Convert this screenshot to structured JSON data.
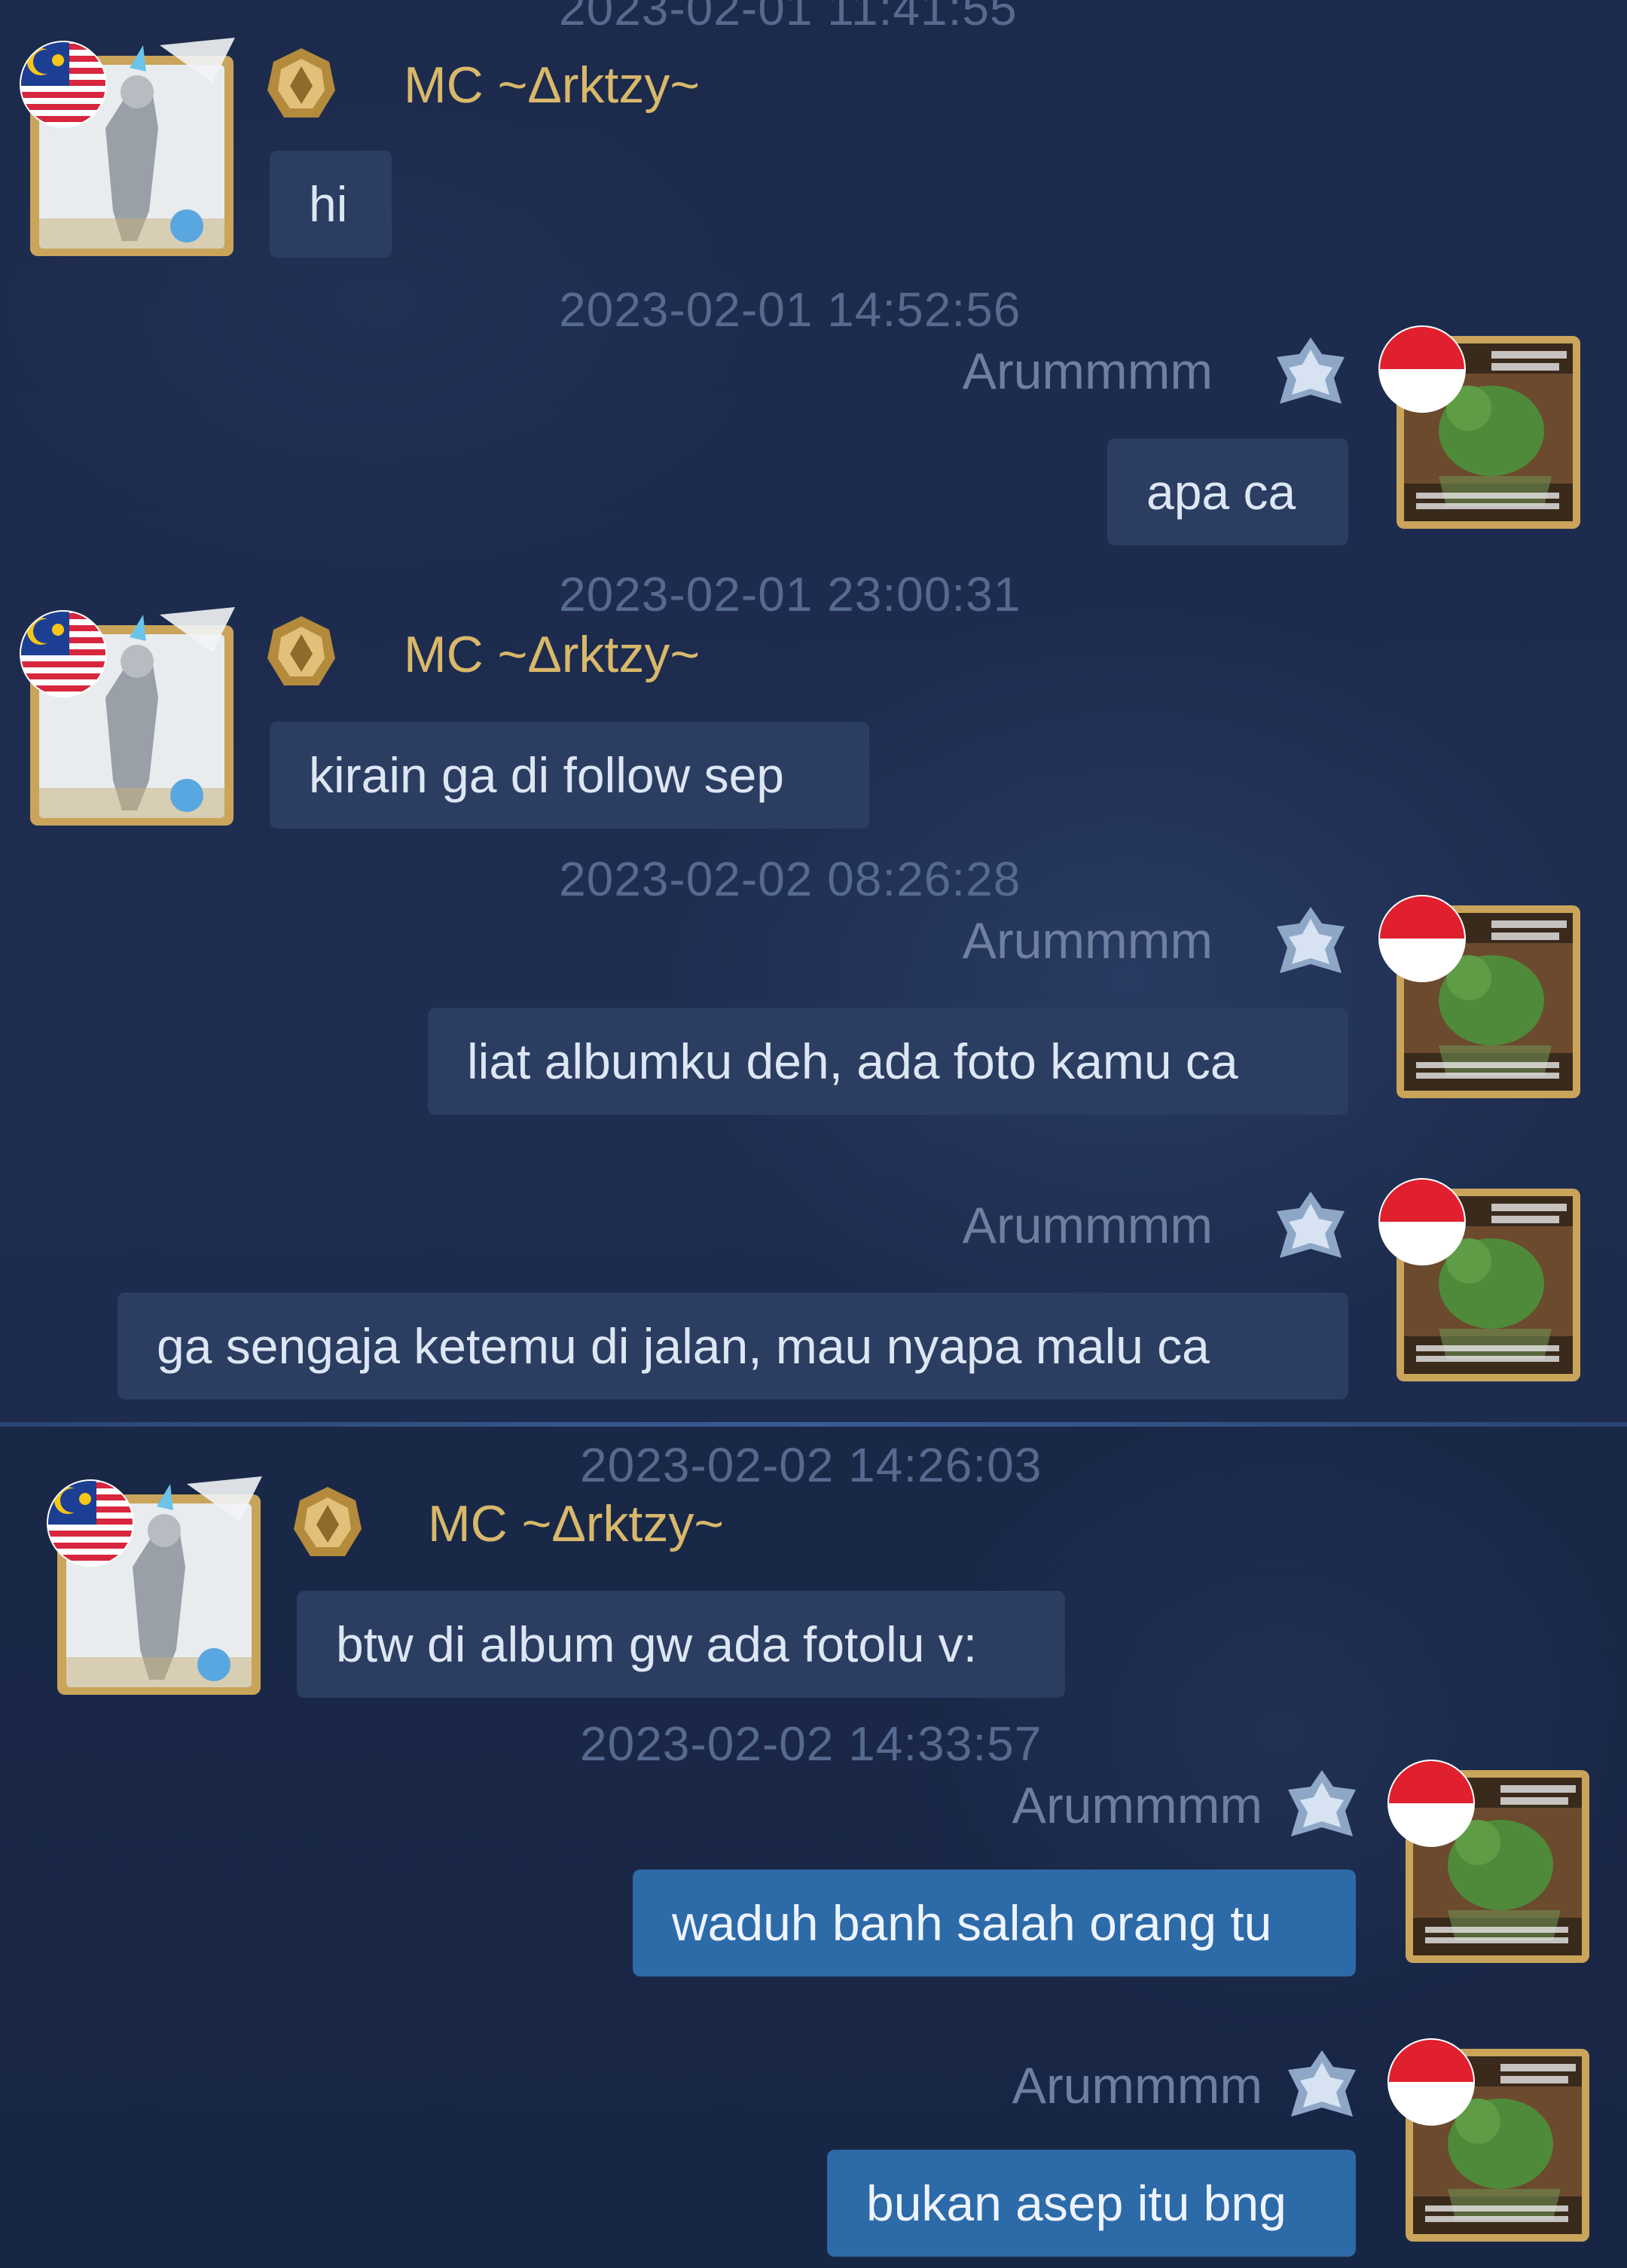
{
  "chat": {
    "partial_timestamp": "2023-02-01 11:41:55",
    "messages": [
      {
        "timestamp": "",
        "sender": "MC ~Δrktzy~",
        "text": "hi",
        "side": "left"
      },
      {
        "timestamp": "2023-02-01 14:52:56",
        "sender": "Arummmm",
        "text": "apa ca",
        "side": "right"
      },
      {
        "timestamp": "2023-02-01 23:00:31",
        "sender": "MC ~Δrktzy~",
        "text": "kirain ga di follow sep",
        "side": "left"
      },
      {
        "timestamp": "2023-02-02 08:26:28",
        "sender": "Arummmm",
        "text": "liat albumku deh, ada foto kamu ca",
        "side": "right"
      },
      {
        "timestamp": "",
        "sender": "Arummmm",
        "text": "ga sengaja ketemu di jalan, mau nyapa malu ca",
        "side": "right"
      },
      {
        "timestamp": "2023-02-02 14:26:03",
        "sender": "MC ~Δrktzy~",
        "text": "btw di album gw ada fotolu v:",
        "side": "left"
      },
      {
        "timestamp": "2023-02-02 14:33:57",
        "sender": "Arummmm",
        "text": "waduh banh salah orang tu",
        "side": "right"
      },
      {
        "timestamp": "",
        "sender": "Arummmm",
        "text": "bukan asep itu bng",
        "side": "right"
      }
    ]
  },
  "colors": {
    "background": "#1c2a4b",
    "bubble": "#2c3d62",
    "bubble_highlight": "#2d6aa8",
    "name_mc": "#d8b86a",
    "name_arummmm": "#6e7f9f",
    "timestamp": "#56698f"
  },
  "icons": {
    "mc_avatar": "hero-portrait-with-malaysia-flag-icon",
    "mc_rank": "gold-rank-badge-icon",
    "aru_avatar": "frog-meme-portrait-with-indonesia-flag-icon",
    "aru_rank": "silver-rank-badge-icon"
  }
}
